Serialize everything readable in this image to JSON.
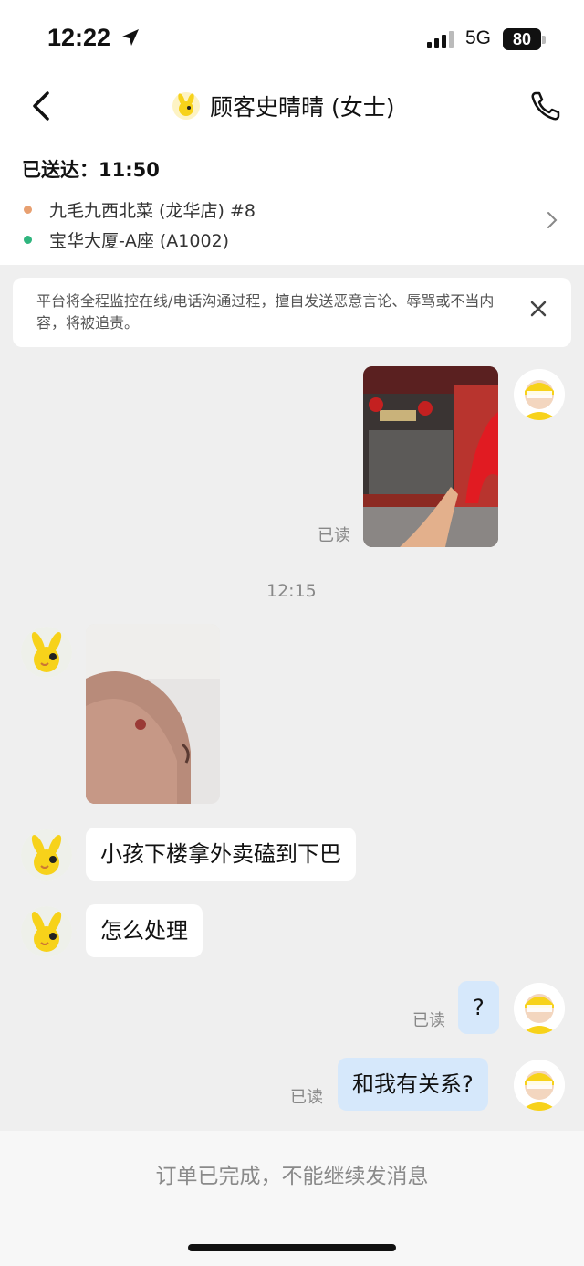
{
  "status_bar": {
    "time": "12:22",
    "network": "5G",
    "battery": "80"
  },
  "header": {
    "title": "顾客史晴晴 (女士)"
  },
  "order": {
    "delivered": "已送达：11:50",
    "shop": "九毛九西北菜 (龙华店) #8",
    "address": "宝华大厦-A座 (A1002)"
  },
  "notice": {
    "text": "平台将全程监控在线/电话沟通过程，擅自发送恶意言论、辱骂或不当内容，将被追责。"
  },
  "messages": {
    "read_label": "已读",
    "time_separator": "12:15",
    "customer_text_1": "小孩下楼拿外卖磕到下巴",
    "customer_text_2": "怎么处理",
    "rider_text_1": "?",
    "rider_text_2": "和我有关系?"
  },
  "footer": {
    "text": "订单已完成，不能继续发消息"
  },
  "colors": {
    "bubble_right": "#d6e8fb",
    "bubble_left": "#ffffff",
    "mascot_yellow": "#f7d21a"
  }
}
